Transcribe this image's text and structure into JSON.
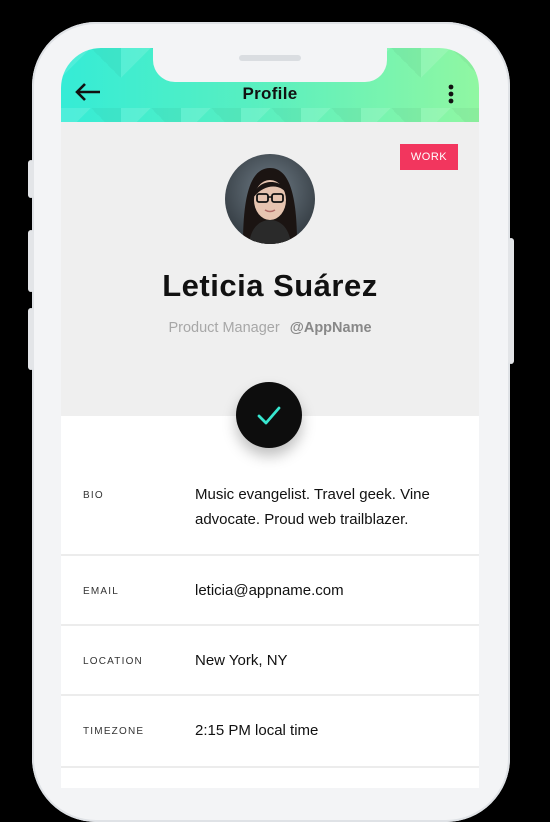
{
  "app_bar": {
    "title": "Profile",
    "back_icon": "arrow-left-icon",
    "menu_icon": "more-vertical-icon",
    "gradient_colors": [
      "#35ecd6",
      "#90f7a2"
    ]
  },
  "profile": {
    "badge": "WORK",
    "badge_color": "#f2365e",
    "name": "Leticia Suárez",
    "role": "Product Manager",
    "handle": "@AppName",
    "action_icon": "checkmark-icon"
  },
  "details": [
    {
      "label": "BIO",
      "value": "Music evangelist. Travel geek. Vine advocate. Proud web trailblazer."
    },
    {
      "label": "EMAIL",
      "value": "leticia@appname.com"
    },
    {
      "label": "LOCATION",
      "value": "New York, NY"
    },
    {
      "label": "TIMEZONE",
      "value": "2:15 PM local time"
    }
  ]
}
